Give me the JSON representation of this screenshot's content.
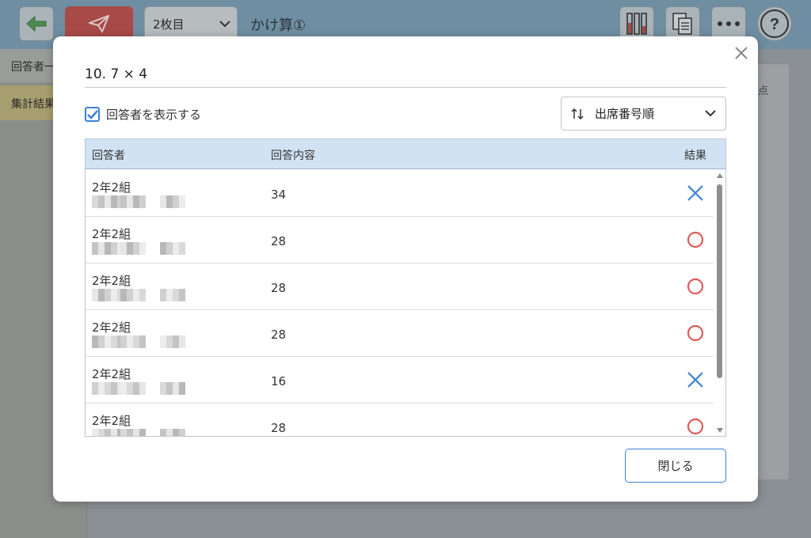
{
  "app": {
    "select_value": "2枚目",
    "title": "かけ算①",
    "side_tab1": "回答者一",
    "side_tab2": "集計結果",
    "bg_card_text": "点"
  },
  "modal": {
    "question": "10.  7 × 4",
    "show_respondents_label": "回答者を表示する",
    "show_respondents_checked": true,
    "sort_label": "出席番号順",
    "close_label": "閉じる"
  },
  "table": {
    "headers": {
      "respondent": "回答者",
      "answer": "回答内容",
      "result": "結果"
    },
    "rows": [
      {
        "class": "2年2組",
        "answer": "34",
        "result": "incorrect"
      },
      {
        "class": "2年2組",
        "answer": "28",
        "result": "correct"
      },
      {
        "class": "2年2組",
        "answer": "28",
        "result": "correct"
      },
      {
        "class": "2年2組",
        "answer": "28",
        "result": "correct"
      },
      {
        "class": "2年2組",
        "answer": "16",
        "result": "incorrect"
      },
      {
        "class": "2年2組",
        "answer": "28",
        "result": "correct"
      }
    ]
  },
  "colors": {
    "correct": "#e05a5a",
    "incorrect": "#3b82d6",
    "header_bg": "#d1e3f3",
    "accent": "#3b82d6"
  }
}
